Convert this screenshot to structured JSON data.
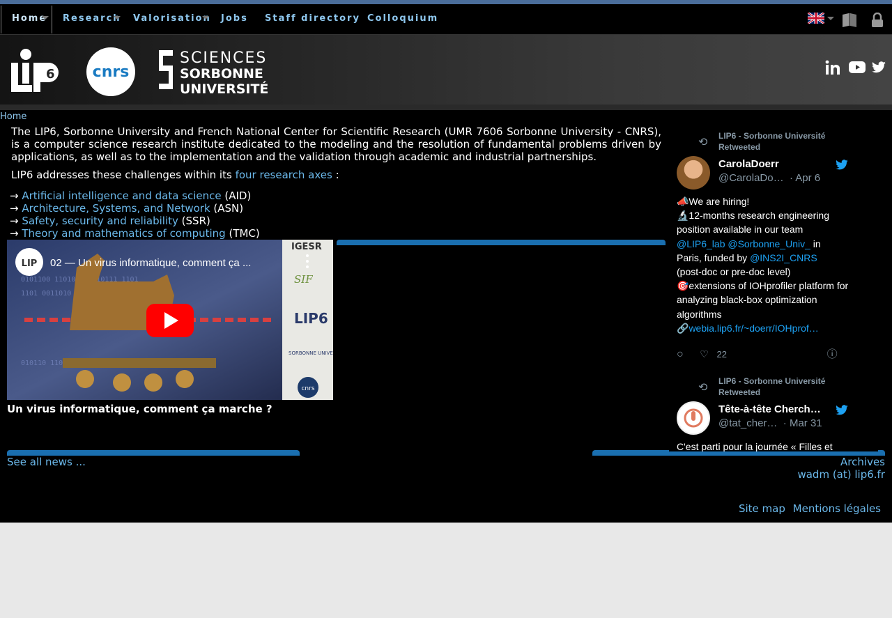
{
  "nav": {
    "items": [
      {
        "label": "Home"
      },
      {
        "label": "Research"
      },
      {
        "label": "Valorisation"
      },
      {
        "label": "Jobs"
      },
      {
        "label": "Staff directory"
      },
      {
        "label": "Colloquium"
      }
    ]
  },
  "header": {
    "logo_lip6": "LIP6",
    "logo_cnrs": "cnrs",
    "logo_su_1": "SCIENCES",
    "logo_su_2": "SORBONNE",
    "logo_su_3": "UNIVERSITÉ",
    "social": [
      "linkedin-icon",
      "youtube-icon",
      "twitter-icon"
    ]
  },
  "breadcrumb": "Home",
  "intro": {
    "paragraph": "The LIP6, Sorbonne University and French National Center for Scientific Research (UMR 7606 Sorbonne University - CNRS), is a computer science research institute dedicated to the modeling and the resolution of fundamental problems driven by applications, as well as to the implementation and the validation through academic and industrial partnerships.",
    "addresses_prefix": "LIP6 addresses these challenges within its",
    "addresses_link": "four research axes",
    "addresses_suffix": " :"
  },
  "axes": [
    {
      "arrow": "→",
      "label": "Artificial intelligence and data science",
      "abbr": " (AID)"
    },
    {
      "arrow": "→",
      "label": "Architecture, Systems, and Network",
      "abbr": " (ASN)"
    },
    {
      "arrow": "→",
      "label": "Safety, security and reliability",
      "abbr": " (SSR)"
    },
    {
      "arrow": "→",
      "label": "Theory and mathematics of computing",
      "abbr": " (TMC)"
    }
  ],
  "video": {
    "title_overlay": "02 — Un virus informatique, comment ça ...",
    "caption": "Un virus informatique, comment ça marche ?",
    "brand_1": "IGESR",
    "brand_2": "SIF",
    "brand_3": "LIP6",
    "brand_4": "SORBONNE UNIVERSITÉ",
    "brand_5": "cnrs"
  },
  "links": {
    "see_all": "See all news ...",
    "archives": "Archives",
    "contact": "wadm (at) lip6.fr",
    "site_map": "Site map",
    "legal": "Mentions légales"
  },
  "twitter": {
    "tweets": [
      {
        "retweeted_by": "LIP6 - Sorbonne Université",
        "retweeted_label": "Retweeted",
        "name": "CarolaDoerr",
        "handle": "@CarolaDo…",
        "date": "· Apr 6",
        "line1": "📣We are hiring!",
        "line2": "🔬12-months research engineering position available in our team",
        "mention1": "@LIP6_lab",
        "mention2": "@Sorbonne_Univ_",
        "line3a": " in",
        "line3b": "Paris, funded by ",
        "mention3": "@INS2I_CNRS",
        "line4": "(post-doc or pre-doc level)",
        "line5": "🎯extensions of IOHprofiler platform for analyzing black-box optimization algorithms",
        "link": "webia.lip6.fr/~doerr/IOHprof…",
        "link_prefix": "🔗",
        "likes": "22"
      },
      {
        "retweeted_by": "LIP6 - Sorbonne Université",
        "retweeted_label": "Retweeted",
        "name": "Tête-à-tête Cherch…",
        "handle": "@tat_cher…",
        "date": "· Mar 31",
        "line1": "C'est parti pour la journée « Filles et"
      }
    ]
  }
}
